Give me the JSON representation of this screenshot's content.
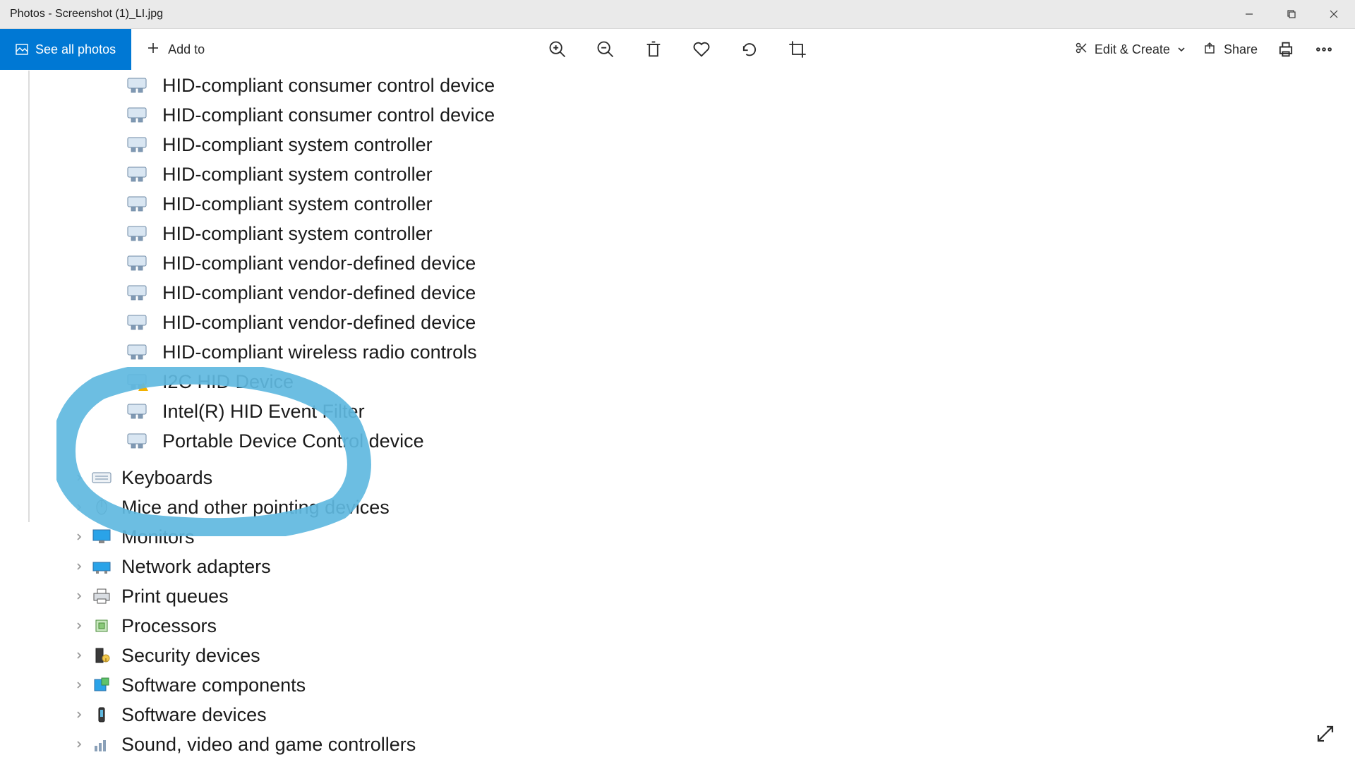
{
  "window": {
    "title": "Photos - Screenshot (1)_LI.jpg"
  },
  "toolbar": {
    "see_all": "See all photos",
    "add_to": "Add to",
    "edit_create": "Edit & Create",
    "share": "Share"
  },
  "devices": {
    "hid_items": [
      "HID-compliant consumer control device",
      "HID-compliant consumer control device",
      "HID-compliant system controller",
      "HID-compliant system controller",
      "HID-compliant system controller",
      "HID-compliant system controller",
      "HID-compliant vendor-defined device",
      "HID-compliant vendor-defined device",
      "HID-compliant vendor-defined device",
      "HID-compliant wireless radio controls",
      "I2C HID Device",
      "Intel(R) HID Event Filter",
      "Portable Device Control device"
    ],
    "warning_index": 10,
    "categories": [
      "Keyboards",
      "Mice and other pointing devices",
      "Monitors",
      "Network adapters",
      "Print queues",
      "Processors",
      "Security devices",
      "Software components",
      "Software devices",
      "Sound, video and game controllers"
    ]
  },
  "colors": {
    "accent": "#0078d4",
    "annotation": "#5fb9e0"
  }
}
